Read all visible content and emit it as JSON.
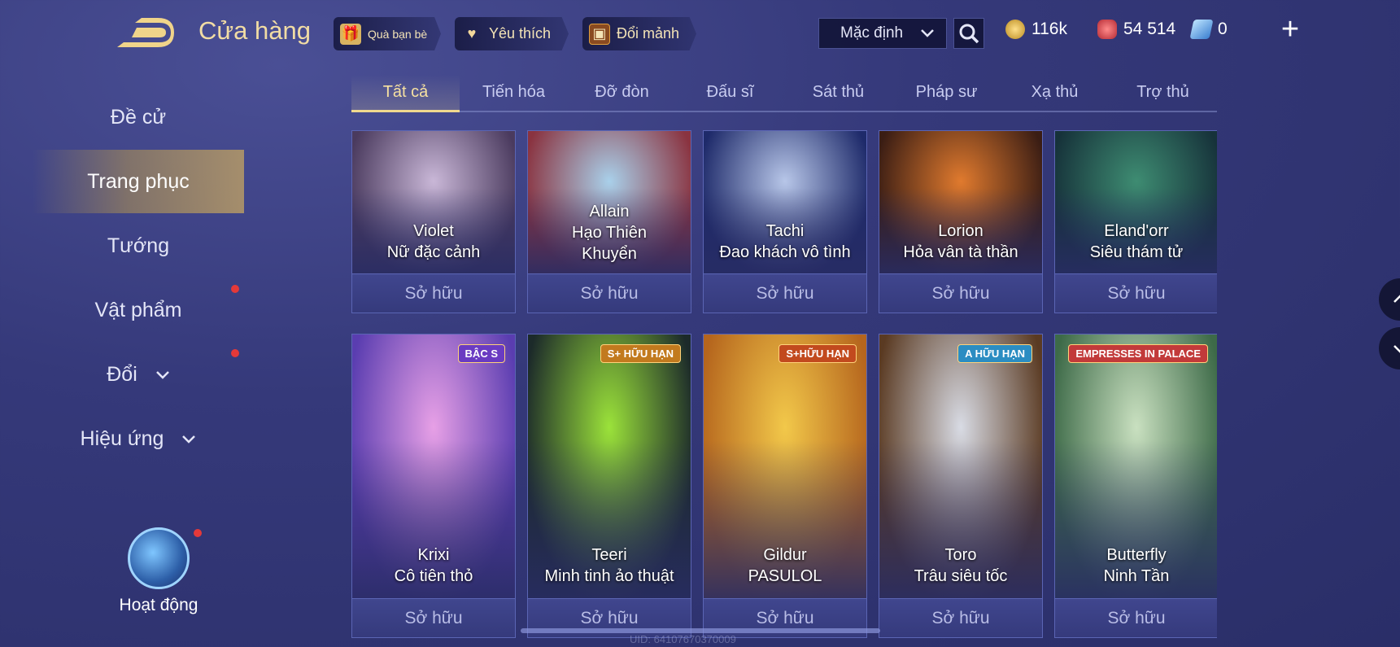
{
  "header": {
    "title": "Cửa hàng",
    "buttons": [
      {
        "label": "Quà bạn bè",
        "icon": "gift-icon"
      },
      {
        "label": "Yêu thích",
        "icon": "heart-icon"
      },
      {
        "label": "Đổi mảnh",
        "icon": "chest-icon"
      }
    ],
    "sort": {
      "selected": "Mặc định"
    },
    "currencies": [
      {
        "value": "116k",
        "icon": "gold-coin-icon",
        "color": "#f1c65a"
      },
      {
        "value": "54 514",
        "icon": "ruby-icon",
        "color": "#e0525a"
      },
      {
        "value": "0",
        "icon": "voucher-icon",
        "color": "#7cc4ff"
      }
    ],
    "plus_label": "+"
  },
  "sidebar": {
    "items": [
      {
        "label": "Đề cử",
        "active": false
      },
      {
        "label": "Trang phục",
        "active": true
      },
      {
        "label": "Tướng",
        "active": false
      },
      {
        "label": "Vật phẩm",
        "active": false,
        "dot": true
      },
      {
        "label": "Đổi",
        "active": false,
        "dot": true,
        "expand": true
      },
      {
        "label": "Hiệu ứng",
        "active": false,
        "expand": true
      }
    ],
    "activity_label": "Hoạt động"
  },
  "tabs": [
    "Tất cả",
    "Tiến hóa",
    "Đỡ đòn",
    "Đấu sĩ",
    "Sát thủ",
    "Pháp sư",
    "Xạ thủ",
    "Trợ thủ"
  ],
  "active_tab": 0,
  "own_label": "Sở hữu",
  "row1": [
    {
      "hero": "Violet",
      "skin": "Nữ đặc cảnh",
      "c1": "#c9b7d7",
      "c2": "#4a3a5e"
    },
    {
      "hero": "Allain",
      "skin": "Hạo Thiên Khuyển",
      "c1": "#a9d0ea",
      "c2": "#8a3340"
    },
    {
      "hero": "Tachi",
      "skin": "Đao khách vô tình",
      "c1": "#b7c6e8",
      "c2": "#1e2a6a"
    },
    {
      "hero": "Lorion",
      "skin": "Hỏa vân tà thần",
      "c1": "#e07a2e",
      "c2": "#3a1d14"
    },
    {
      "hero": "Eland'orr",
      "skin": "Siêu thám tử",
      "c1": "#3e8c72",
      "c2": "#16323a"
    }
  ],
  "row2": [
    {
      "hero": "Krixi",
      "skin": "Cô tiên thỏ",
      "badge": "BẬC S",
      "badge_color": "#6a3bc2",
      "c1": "#e7a0e6",
      "c2": "#5a3db0"
    },
    {
      "hero": "Teeri",
      "skin": "Minh tinh ảo thuật",
      "badge": "S+ HỮU HẠN",
      "badge_color": "#c27a1e",
      "c1": "#9be23a",
      "c2": "#1c2a2a"
    },
    {
      "hero": "Gildur",
      "skin": "PASULOL",
      "badge": "S+HỮU HẠN",
      "badge_color": "#c24a1e",
      "c1": "#f2c84a",
      "c2": "#b5651d"
    },
    {
      "hero": "Toro",
      "skin": "Trâu siêu tốc",
      "badge": "A HỮU HẠN",
      "badge_color": "#2b8dc2",
      "c1": "#d8dbe4",
      "c2": "#5a3a22"
    },
    {
      "hero": "Butterfly",
      "skin": "Ninh Tần",
      "badge": "EMPRESSES IN PALACE",
      "badge_color": "#c23a3a",
      "c1": "#c9e0c0",
      "c2": "#3d6a48"
    }
  ],
  "uid_text": "UID: 64107670370009"
}
